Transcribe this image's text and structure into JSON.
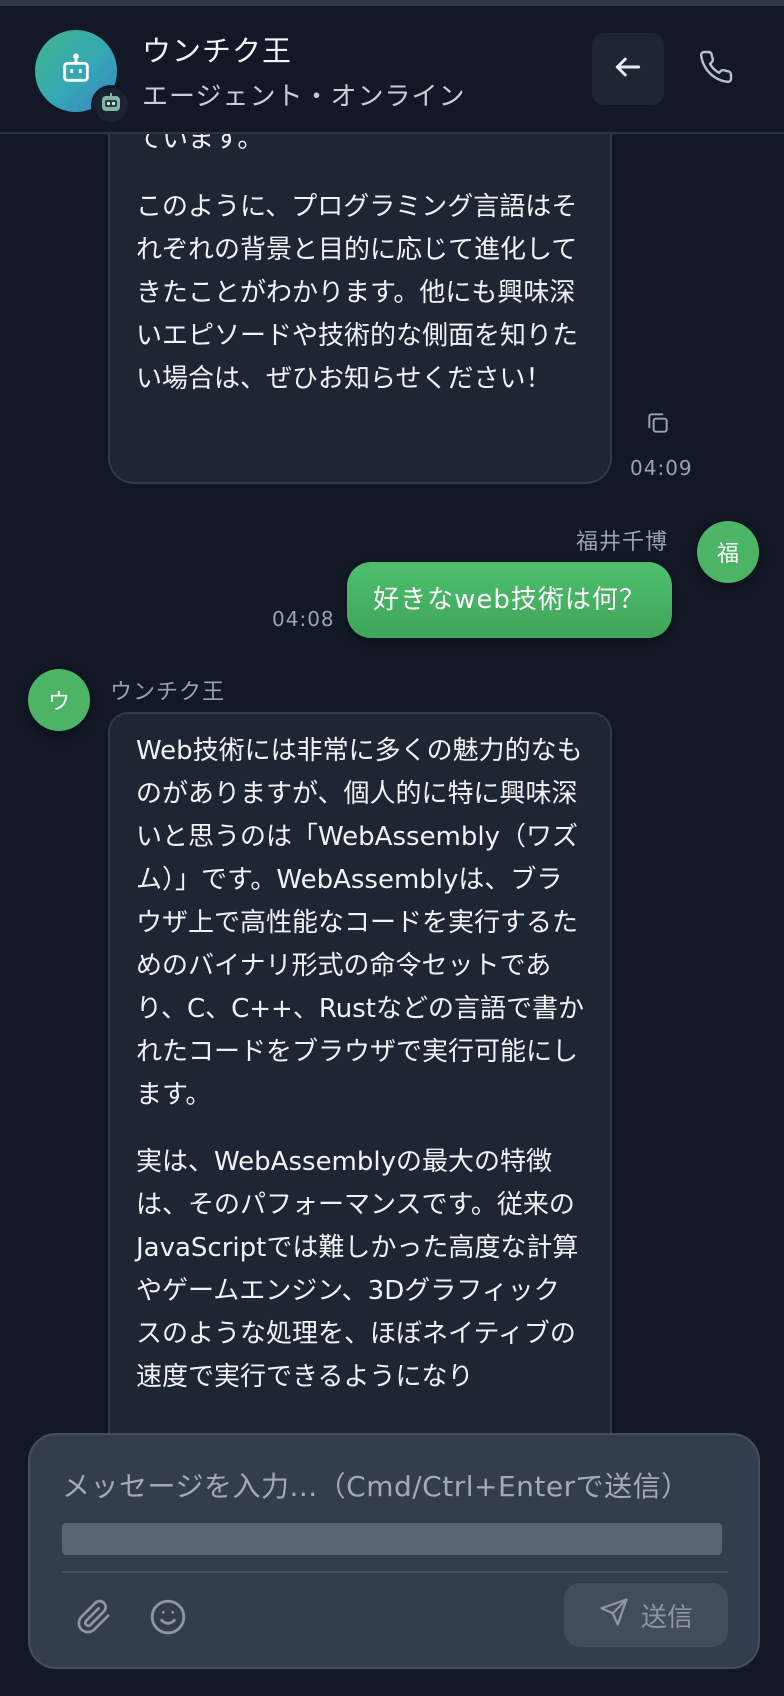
{
  "header": {
    "title": "ウンチク王",
    "subtitle": "エージェント・オンライン"
  },
  "messages": {
    "bot_prev": {
      "paragraph1": "ています。",
      "paragraph2": "このように、プログラミング言語はそれぞれの背景と目的に応じて進化してきたことがわかります。他にも興味深いエピソードや技術的な側面を知りたい場合は、ぜひお知らせください！",
      "time": "04:09"
    },
    "user": {
      "name": "福井千博",
      "avatar": "福",
      "text": "好きなweb技術は何？",
      "time": "04:08"
    },
    "bot_current": {
      "name": "ウンチク王",
      "avatar": "ウ",
      "paragraph1": "Web技術には非常に多くの魅力的なものがありますが、個人的に特に興味深いと思うのは「WebAssembly（ワズム）」です。WebAssemblyは、ブラウザ上で高性能なコードを実行するためのバイナリ形式の命令セットであり、C、C++、Rustなどの言語で書かれたコードをブラウザで実行可能にします。",
      "paragraph2": "実は、WebAssemblyの最大の特徴は、そのパフォーマンスです。従来のJavaScriptでは難しかった高度な計算やゲームエンジン、3Dグラフィックスのような処理を、ほぼネイティブの速度で実行できるようになり"
    }
  },
  "composer": {
    "placeholder": "メッセージを入力...（Cmd/Ctrl+Enterで送信）",
    "send_label": "送信"
  },
  "icons": {
    "avatar": "robot-icon",
    "badge": "robot-face-icon",
    "back": "arrow-left-icon",
    "call": "phone-icon",
    "copy": "copy-icon",
    "attach": "paperclip-icon",
    "emoji": "smiley-icon",
    "send": "send-icon"
  },
  "colors": {
    "background": "#121826",
    "bubble": "#1f2633",
    "user_bubble": "#45b162",
    "composer": "#343d4d"
  }
}
